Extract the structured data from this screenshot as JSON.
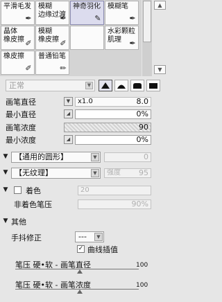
{
  "tools": [
    {
      "label": "平滑毛发",
      "icon": "brush-icon"
    },
    {
      "label": "模糊\n边缘过渡",
      "icon": "brush-icon"
    },
    {
      "label": "神奇羽化",
      "icon": "feather-icon",
      "selected": true
    },
    {
      "label": "模糊笔",
      "icon": "brush-icon"
    },
    {
      "label": "晶体\n橡皮擦",
      "icon": "pen-icon"
    },
    {
      "label": "模糊\n橡皮擦",
      "icon": "pen-icon"
    },
    {
      "label": "",
      "icon": ""
    },
    {
      "label": "水彩颗粒\n肌理",
      "icon": "brush-icon"
    },
    {
      "label": "橡皮擦",
      "icon": "pen-icon"
    },
    {
      "label": "普通铅笔",
      "icon": "pencil-icon"
    }
  ],
  "blend": {
    "mode": "正常"
  },
  "brush": {
    "size_label": "画笔直径",
    "size_multiplier": "x1.0",
    "size_value": "8.0",
    "min_size_label": "最小直径",
    "min_size_value": "0%",
    "density_label": "画笔浓度",
    "density_value": "90",
    "density_level": 0.9,
    "min_density_label": "最小浓度",
    "min_density_value": "0%"
  },
  "shape": {
    "name": "【通用的圆形】",
    "strength": "0"
  },
  "texture": {
    "name": "【无纹理】",
    "strength_label": "强度",
    "strength_value": "95"
  },
  "color": {
    "label": "着色",
    "value": "20",
    "non_color_label": "非着色笔压",
    "non_color_value": "90%"
  },
  "other": {
    "section_label": "其他",
    "stabilizer_label": "手抖修正",
    "stabilizer_value": "---",
    "curve_label": "曲线插值",
    "curve_checked": true,
    "pressure1_label": "笔压 硬•软 - 画笔直径",
    "pressure1_value": "100",
    "pressure2_label": "笔压 硬•软 - 画笔浓度",
    "pressure2_value": "100"
  },
  "colors": {
    "accent": "#c8c8da",
    "selected_tool": "#dcdcee"
  }
}
